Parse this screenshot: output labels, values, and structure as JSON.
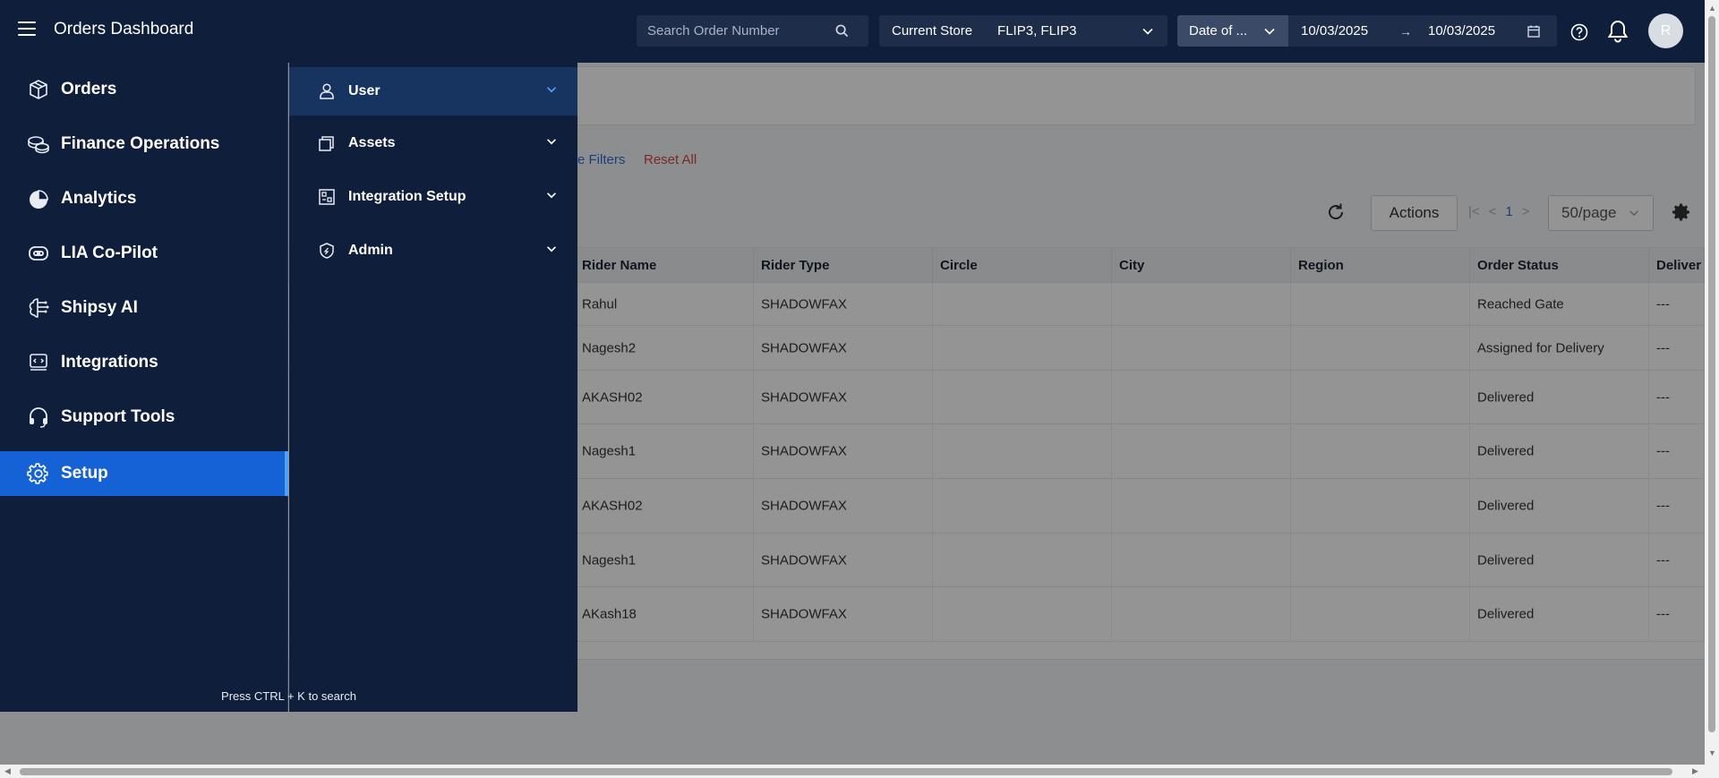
{
  "header": {
    "title": "Orders Dashboard",
    "search_placeholder": "Search Order Number",
    "store_label": "Current Store",
    "store_value": "FLIP3, FLIP3",
    "date_type": "Date of ...",
    "date_from": "10/03/2025",
    "date_arrow": "→",
    "date_to": "10/03/2025",
    "avatar_initial": "R"
  },
  "filters": {
    "more_filters": "re Filters",
    "reset_all": "Reset All"
  },
  "toolbar": {
    "actions_label": "Actions",
    "page_first": "|<",
    "page_prev": "<",
    "current_page": "1",
    "page_next": ">",
    "per_page": "50/page"
  },
  "table": {
    "columns": [
      "Rider Name",
      "Rider Type",
      "Circle",
      "City",
      "Region",
      "Order Status",
      "Deliver"
    ],
    "rows": [
      [
        "Rahul",
        "SHADOWFAX",
        "",
        "",
        "",
        "Reached Gate",
        "---"
      ],
      [
        "Nagesh2",
        "SHADOWFAX",
        "",
        "",
        "",
        "Assigned for Delivery",
        "---"
      ],
      [
        "AKASH02",
        "SHADOWFAX",
        "",
        "",
        "",
        "Delivered",
        "---"
      ],
      [
        "Nagesh1",
        "SHADOWFAX",
        "",
        "",
        "",
        "Delivered",
        "---"
      ],
      [
        "AKASH02",
        "SHADOWFAX",
        "",
        "",
        "",
        "Delivered",
        "---"
      ],
      [
        "Nagesh1",
        "SHADOWFAX",
        "",
        "",
        "",
        "Delivered",
        "---"
      ],
      [
        "AKash18",
        "SHADOWFAX",
        "",
        "",
        "",
        "Delivered",
        "---"
      ]
    ]
  },
  "sidebar": {
    "items": [
      {
        "label": "Orders",
        "icon": "box-icon"
      },
      {
        "label": "Finance Operations",
        "icon": "coins-icon"
      },
      {
        "label": "Analytics",
        "icon": "pie-chart-icon"
      },
      {
        "label": "LIA Co-Pilot",
        "icon": "copilot-icon"
      },
      {
        "label": "Shipsy AI",
        "icon": "ai-brain-icon"
      },
      {
        "label": "Integrations",
        "icon": "integrations-icon"
      },
      {
        "label": "Support Tools",
        "icon": "headset-icon"
      },
      {
        "label": "Setup",
        "icon": "gear-icon",
        "active": true
      }
    ]
  },
  "submenu": {
    "items": [
      {
        "label": "User",
        "icon": "user-icon",
        "open": true
      },
      {
        "label": "Assets",
        "icon": "assets-icon"
      },
      {
        "label": "Integration Setup",
        "icon": "integration-setup-icon"
      },
      {
        "label": "Admin",
        "icon": "admin-shield-icon"
      }
    ]
  },
  "hint": "Press CTRL + K to search",
  "colors": {
    "nav_bg": "#0f1e3a",
    "active_bg": "#1561d6",
    "link_blue": "#2f6fd1",
    "reset_red": "#d64545"
  }
}
